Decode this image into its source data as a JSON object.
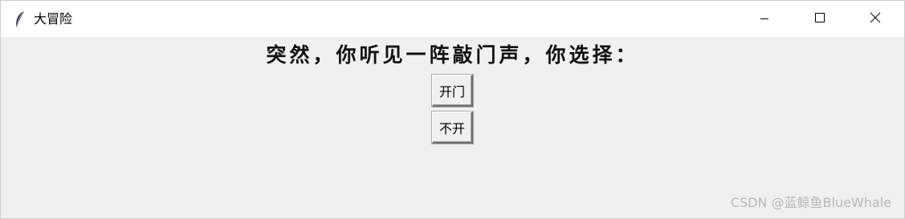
{
  "window": {
    "title": "大冒险",
    "icons": {
      "app": "feather-icon",
      "minimize": "minimize-icon",
      "maximize": "maximize-icon",
      "close": "close-icon"
    }
  },
  "main": {
    "prompt": "突然，你听见一阵敲门声，你选择：",
    "buttons": [
      {
        "label": "开门"
      },
      {
        "label": "不开"
      }
    ]
  },
  "watermark": "CSDN @蓝鲸鱼BlueWhale",
  "colors": {
    "client_bg": "#f0f0f0",
    "titlebar_bg": "#ffffff",
    "text": "#000000"
  }
}
